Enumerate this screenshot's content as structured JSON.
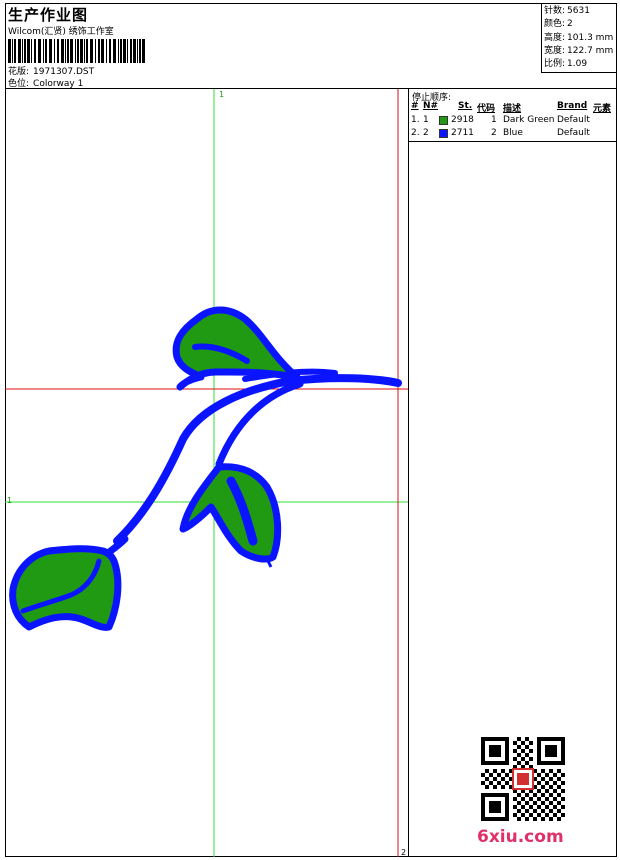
{
  "header": {
    "title": "生产作业图",
    "company": "Wilcom(汇贤) 绣饰工作室",
    "pattern_label": "花版:",
    "pattern_value": "1971307.DST",
    "colorway_label": "色位:",
    "colorway_value": "Colorway 1"
  },
  "stats": {
    "stitches_label": "针数:",
    "stitches_value": "5631",
    "colors_label": "颜色:",
    "colors_value": "2",
    "height_label": "高度:",
    "height_value": "101.3 mm",
    "width_label": "宽度:",
    "width_value": "122.7 mm",
    "scale_label": "比例:",
    "scale_value": "1.09"
  },
  "design": {
    "marker_top": "1",
    "marker_left": "1",
    "marker_bottom": "2",
    "colors": {
      "dark_green": "#1f9a12",
      "blue": "#0a14ff",
      "guide_green": "#33dd33",
      "guide_red": "#dd1111"
    }
  },
  "stop_sequence": {
    "title": "停止顺序:",
    "columns": [
      "#",
      "N#",
      "St.",
      "代码",
      "描述",
      "Brand",
      "元素"
    ],
    "rows": [
      {
        "index": "1.",
        "needle": "1",
        "color": "#1f9a12",
        "stitch": "2918",
        "code": "1",
        "description": "Dark Green",
        "brand": "Default"
      },
      {
        "index": "2.",
        "needle": "2",
        "color": "#0a14ff",
        "stitch": "2711",
        "code": "2",
        "description": "Blue",
        "brand": "Default"
      }
    ]
  },
  "watermark": "6xiu.com",
  "icons": {
    "qr": "qr-code-icon",
    "seal": "seal-stamp-icon"
  }
}
